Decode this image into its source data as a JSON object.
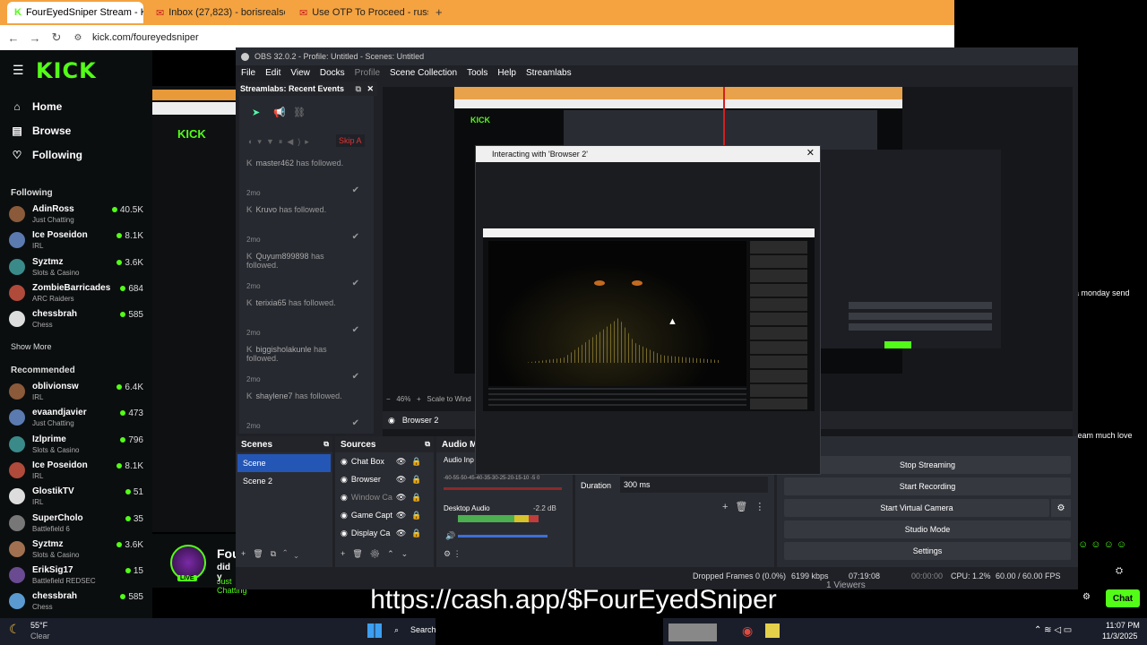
{
  "browser": {
    "tabs": [
      {
        "label": "FourEyedSniper Stream - Kick"
      },
      {
        "label": "Inbox (27,823) - borisrealson@"
      },
      {
        "label": "Use OTP To Proceed - russianc"
      }
    ],
    "url": "kick.com/foureyedsniper"
  },
  "kick": {
    "logo": "KICK",
    "nav": {
      "home": "Home",
      "browse": "Browse",
      "following": "Following"
    },
    "following_header": "Following",
    "following": [
      {
        "name": "AdinRoss",
        "sub": "Just Chatting",
        "viewers": "40.5K"
      },
      {
        "name": "Ice Poseidon",
        "sub": "IRL",
        "viewers": "8.1K"
      },
      {
        "name": "Syztmz",
        "sub": "Slots & Casino",
        "viewers": "3.6K"
      },
      {
        "name": "ZombieBarricades",
        "sub": "ARC Raiders",
        "viewers": "684"
      },
      {
        "name": "chessbrah",
        "sub": "Chess",
        "viewers": "585"
      }
    ],
    "show_more": "Show More",
    "recommended_header": "Recommended",
    "recommended": [
      {
        "name": "oblivionsw",
        "sub": "IRL",
        "viewers": "6.4K"
      },
      {
        "name": "evaandjavier",
        "sub": "Just Chatting",
        "viewers": "473"
      },
      {
        "name": "Izlprime",
        "sub": "Slots & Casino",
        "viewers": "796"
      },
      {
        "name": "Ice Poseidon",
        "sub": "IRL",
        "viewers": "8.1K"
      },
      {
        "name": "GlostikTV",
        "sub": "IRL",
        "viewers": "51"
      },
      {
        "name": "SuperCholo",
        "sub": "Battlefield 6",
        "viewers": "35"
      },
      {
        "name": "Syztmz",
        "sub": "Slots & Casino",
        "viewers": "3.6K"
      },
      {
        "name": "ErikSig17",
        "sub": "Battlefield REDSEC",
        "viewers": "15"
      },
      {
        "name": "chessbrah",
        "sub": "Chess",
        "viewers": "585"
      }
    ],
    "right_chat": [
      "a monday send",
      "tream much love"
    ],
    "chat_button": "Chat"
  },
  "obs": {
    "title": "OBS 32.0.2 - Profile: Untitled - Scenes: Untitled",
    "menu": [
      "File",
      "Edit",
      "View",
      "Docks",
      "Profile",
      "Scene Collection",
      "Tools",
      "Help",
      "Streamlabs"
    ],
    "events_title": "Streamlabs: Recent Events",
    "skip": "Skip A",
    "events": [
      {
        "who": "master462",
        "text": "has followed.",
        "ago": "2mo"
      },
      {
        "who": "Kruvo",
        "text": "has followed.",
        "ago": "2mo"
      },
      {
        "who": "Quyum899898",
        "text": "has followed.",
        "ago": "2mo"
      },
      {
        "who": "terixia65",
        "text": "has followed.",
        "ago": "2mo"
      },
      {
        "who": "biggisholakunle",
        "text": "has followed.",
        "ago": "2mo"
      },
      {
        "who": "shaylene7",
        "text": "has followed.",
        "ago": "2mo"
      }
    ],
    "preview_zoom": "46%",
    "scale_label": "Scale to Wind",
    "source_name": "Browser 2",
    "scenes_title": "Scenes",
    "scenes": [
      "Scene",
      "Scene 2"
    ],
    "sources_title": "Sources",
    "sources": [
      "Chat Box",
      "Browser",
      "Window Ca",
      "Game Capt",
      "Display Ca"
    ],
    "mixer_title": "Audio M",
    "audio_input": "Audio Inp",
    "desktop_audio": "Desktop Audio",
    "desktop_db": "-2.2 dB",
    "meter_ticks": "-60-55-50-45-40-35-30-25-20-15-10 -5  0",
    "duration_label": "Duration",
    "duration_value": "300 ms",
    "controls": [
      "Stop Streaming",
      "Start Recording",
      "Start Virtual Camera",
      "Studio Mode",
      "Settings"
    ],
    "status": {
      "dropped": "Dropped Frames 0 (0.0%)",
      "kbps": "6199 kbps",
      "live_time": "07:19:08",
      "rec_time": "00:00:00",
      "cpu": "CPU: 1.2%",
      "fps": "60.00 / 60.00 FPS"
    }
  },
  "dialog": {
    "title": "Interacting with 'Browser 2'"
  },
  "stream": {
    "name": "Fou",
    "sub": "did y",
    "live": "LIVE",
    "category": "Just Chatting",
    "viewers": "1 Viewers"
  },
  "overlay": {
    "cashapp": "https://cash.app/$FourEyedSniper"
  },
  "taskbar": {
    "weather_temp": "55°F",
    "weather_desc": "Clear",
    "search": "Search",
    "time": "11:07 PM",
    "date": "11/3/2025"
  }
}
